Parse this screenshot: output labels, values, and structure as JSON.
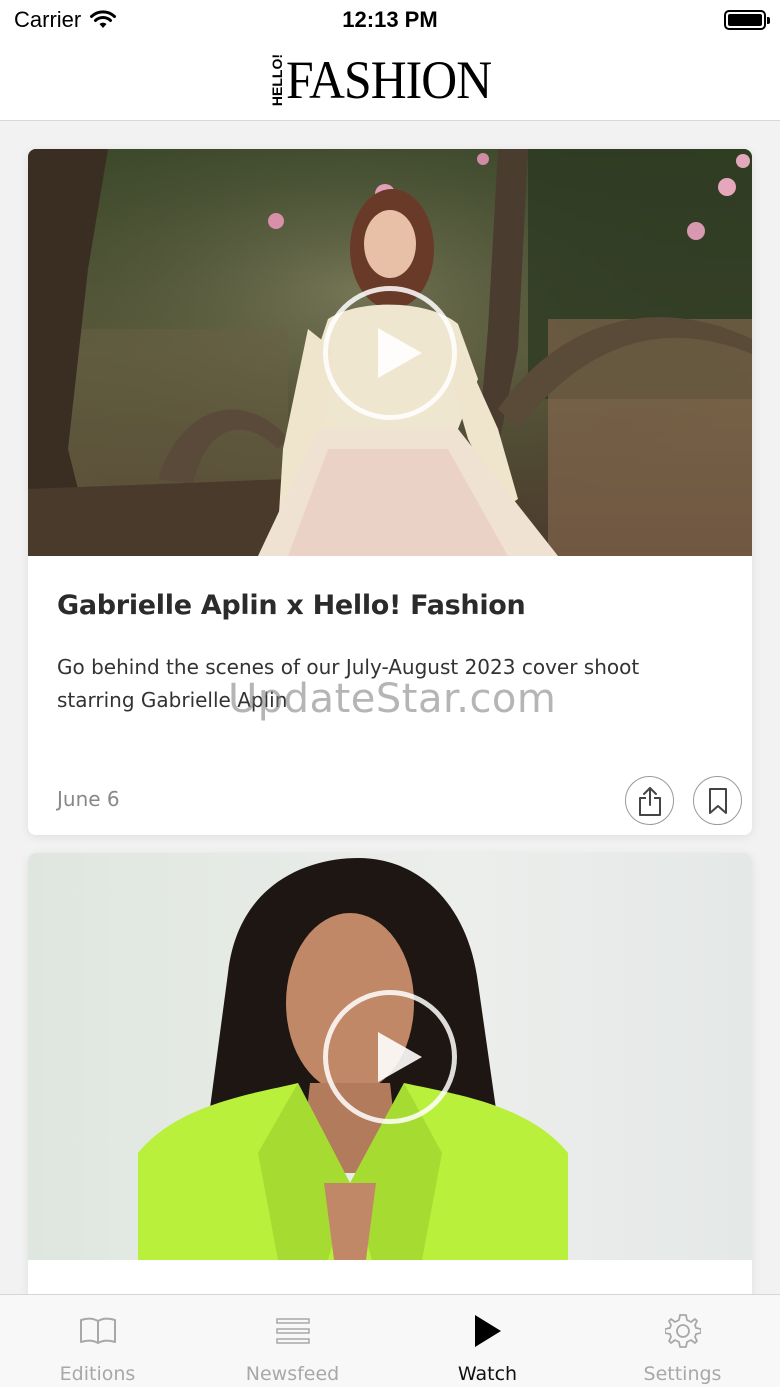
{
  "status_bar": {
    "carrier": "Carrier",
    "time": "12:13 PM",
    "wifi_icon": "wifi-icon",
    "battery_icon": "battery-icon"
  },
  "header": {
    "logo_small": "HELLO!",
    "logo_main": "FASHION"
  },
  "feed": {
    "items": [
      {
        "title": "Gabrielle Aplin x Hello! Fashion",
        "description": "Go behind the scenes of our July-August 2023 cover shoot starring Gabrielle Aplin",
        "date": "June 6",
        "play_icon": "play-icon",
        "share_icon": "share-icon",
        "bookmark_icon": "bookmark-icon"
      },
      {
        "title": "",
        "description": "",
        "date": "",
        "play_icon": "play-icon"
      }
    ]
  },
  "watermark": "UpdateStar.com",
  "tab_bar": {
    "tabs": [
      {
        "label": "Editions",
        "icon": "book-icon",
        "active": false
      },
      {
        "label": "Newsfeed",
        "icon": "list-icon",
        "active": false
      },
      {
        "label": "Watch",
        "icon": "play-icon",
        "active": true
      },
      {
        "label": "Settings",
        "icon": "gear-icon",
        "active": false
      }
    ]
  },
  "colors": {
    "active_tab": "#111111",
    "inactive_tab": "#a8a8a8",
    "blazer_green": "#b8f03c"
  }
}
